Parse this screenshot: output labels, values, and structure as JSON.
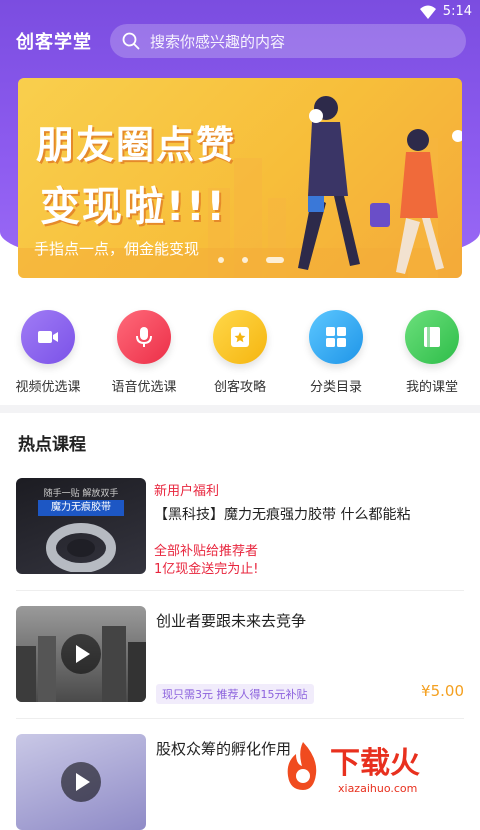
{
  "status_bar": {
    "time": "5:14"
  },
  "header": {
    "app_title": "创客学堂",
    "search_placeholder": "搜索你感兴趣的内容"
  },
  "banner": {
    "line1": "朋友圈点赞",
    "line2": "变现啦!!!",
    "subtitle": "手指点一点，佣金能变现",
    "slide_count": 3,
    "active_slide": 3
  },
  "quick_entries": [
    {
      "label": "视频优选课",
      "icon": "video-camera-icon",
      "color": "#8e66f0"
    },
    {
      "label": "语音优选课",
      "icon": "microphone-icon",
      "color": "#f2475a"
    },
    {
      "label": "创客攻略",
      "icon": "star-card-icon",
      "color": "#f8c21e"
    },
    {
      "label": "分类目录",
      "icon": "grid-icon",
      "color": "#2fa9f0"
    },
    {
      "label": "我的课堂",
      "icon": "book-icon",
      "color": "#46cc5c"
    }
  ],
  "section": {
    "title": "热点课程"
  },
  "courses": [
    {
      "label": "新用户福利",
      "title": "【黑科技】魔力无痕强力胶带 什么都能粘",
      "promo1": "全部补贴给推荐者",
      "promo2": "1亿现金送完为止!",
      "thumb_text1": "随手一贴 解放双手",
      "thumb_text2": "魔力无痕胶带"
    },
    {
      "title": "创业者要跟未来去竞争",
      "tag": "现只需3元 推荐人得15元补贴",
      "price": "¥5.00"
    },
    {
      "title": "股权众筹的孵化作用"
    }
  ],
  "watermark": {
    "text": "下载火",
    "domain": "xiazaihuo.com"
  }
}
